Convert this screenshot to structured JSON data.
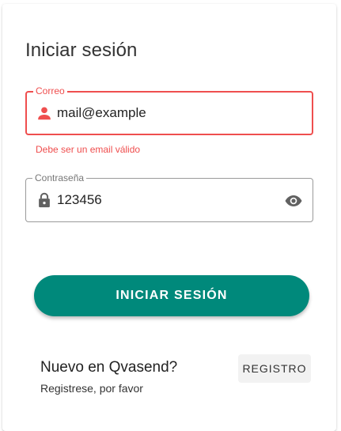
{
  "login": {
    "title": "Iniciar sesión",
    "email": {
      "label": "Correo",
      "value": "mail@example",
      "error": "Debe ser un email válido",
      "icon": "person-icon",
      "error_color": "#ef4e4e"
    },
    "password": {
      "label": "Contraseña",
      "value": "123456",
      "icon": "lock-icon",
      "toggle_icon": "eye-icon"
    },
    "submit_label": "INICIAR SESIÓN",
    "accent_color": "#00897b"
  },
  "signup": {
    "title": "Nuevo en Qvasend?",
    "subtitle": "Registrese, por favor",
    "button_label": "REGISTRO"
  }
}
